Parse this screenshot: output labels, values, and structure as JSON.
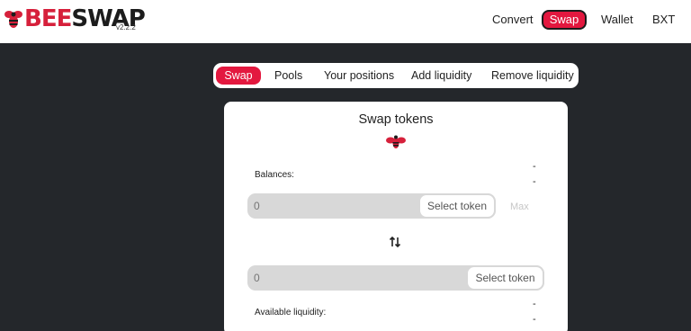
{
  "header": {
    "logo": {
      "bee_text": "BEE",
      "swap_text": "SWAP",
      "reg_mark": "®",
      "version": "v2.2.2"
    },
    "nav": {
      "convert": "Convert",
      "swap": "Swap",
      "wallet": "Wallet",
      "bxt": "BXT"
    }
  },
  "tabs": [
    "Swap",
    "Pools",
    "Your positions",
    "Add liquidity",
    "Remove liquidity"
  ],
  "card": {
    "title": "Swap tokens",
    "balances_label": "Balances:",
    "balance_1": "-",
    "balance_2": "-",
    "from": {
      "amount_placeholder": "0",
      "select_label": "Select token",
      "max_label": "Max"
    },
    "to": {
      "amount_placeholder": "0",
      "select_label": "Select token"
    },
    "available_liquidity_label": "Available liquidity:",
    "liquidity_1": "-",
    "liquidity_2": "-"
  },
  "colors": {
    "brand_red": "#e3183f",
    "background": "#24272b"
  }
}
